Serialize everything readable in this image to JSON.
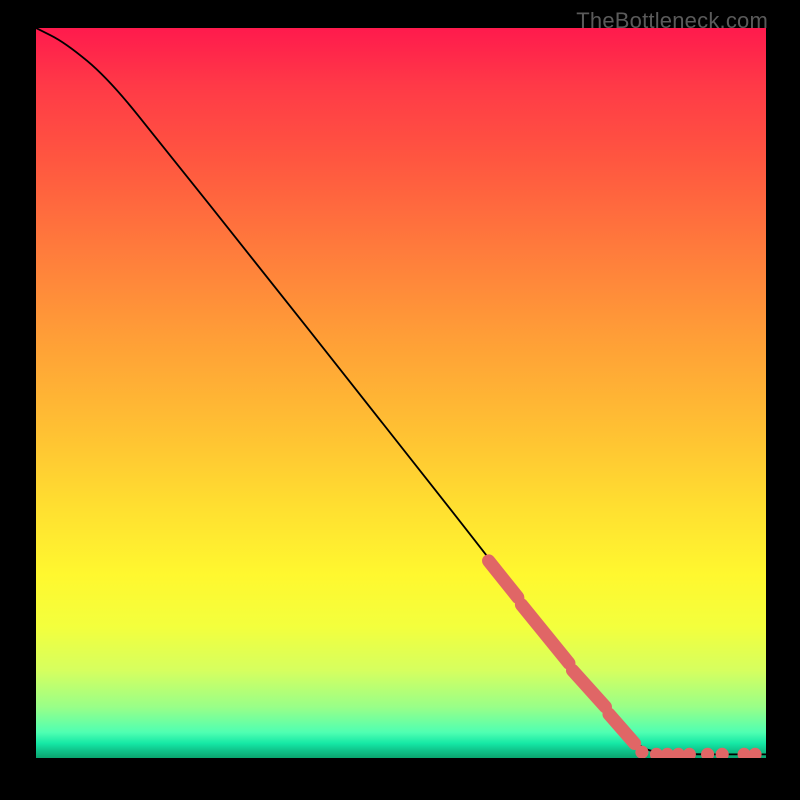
{
  "watermark": "TheBottleneck.com",
  "chart_data": {
    "type": "line",
    "title": "",
    "xlabel": "",
    "ylabel": "",
    "xlim": [
      0,
      100
    ],
    "ylim": [
      0,
      100
    ],
    "curve": [
      {
        "x": 0,
        "y": 100
      },
      {
        "x": 4,
        "y": 98
      },
      {
        "x": 10,
        "y": 93
      },
      {
        "x": 18,
        "y": 83
      },
      {
        "x": 30,
        "y": 68
      },
      {
        "x": 45,
        "y": 49
      },
      {
        "x": 60,
        "y": 30
      },
      {
        "x": 70,
        "y": 17
      },
      {
        "x": 78,
        "y": 7
      },
      {
        "x": 82,
        "y": 2
      },
      {
        "x": 85,
        "y": 0.5
      },
      {
        "x": 100,
        "y": 0.5
      }
    ],
    "marker_segments": [
      {
        "x1": 62,
        "y1": 27,
        "x2": 66,
        "y2": 22
      },
      {
        "x1": 66.5,
        "y1": 21,
        "x2": 73,
        "y2": 13
      },
      {
        "x1": 73.5,
        "y1": 12,
        "x2": 78,
        "y2": 7
      },
      {
        "x1": 78.5,
        "y1": 6,
        "x2": 82,
        "y2": 2
      }
    ],
    "marker_dots": [
      {
        "x": 83,
        "y": 0.8
      },
      {
        "x": 85,
        "y": 0.5
      },
      {
        "x": 86.5,
        "y": 0.5
      },
      {
        "x": 88,
        "y": 0.5
      },
      {
        "x": 89.5,
        "y": 0.5
      },
      {
        "x": 92,
        "y": 0.5
      },
      {
        "x": 94,
        "y": 0.5
      },
      {
        "x": 97,
        "y": 0.5
      },
      {
        "x": 98.5,
        "y": 0.5
      }
    ],
    "colors": {
      "curve": "#000000",
      "marker": "#e06666"
    }
  }
}
